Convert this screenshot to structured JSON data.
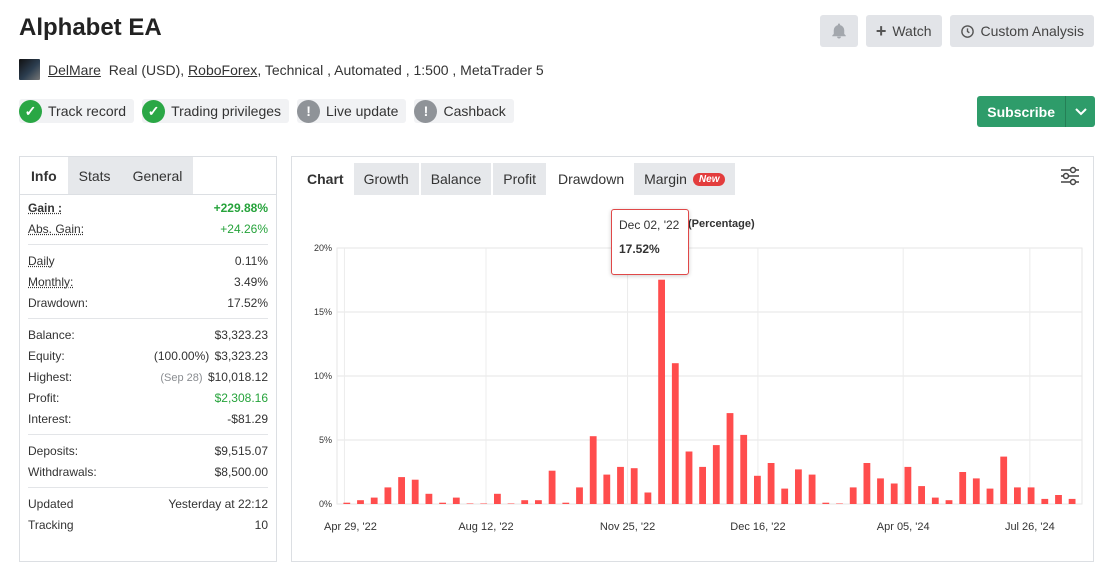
{
  "header": {
    "title": "Alphabet EA",
    "watch_label": "Watch",
    "custom_label": "Custom Analysis",
    "user": "DelMare",
    "account_type": "Real (USD),",
    "broker": "RoboForex",
    "details": ", Technical , Automated , 1:500 , MetaTrader 5"
  },
  "badges": [
    {
      "label": "Track record",
      "status": "ok"
    },
    {
      "label": "Trading privileges",
      "status": "ok"
    },
    {
      "label": "Live update",
      "status": "warn"
    },
    {
      "label": "Cashback",
      "status": "warn"
    }
  ],
  "subscribe_label": "Subscribe",
  "left_tabs": [
    "Info",
    "Stats",
    "General"
  ],
  "stats": {
    "gain_label": "Gain :",
    "gain": "+229.88%",
    "abs_gain_label": "Abs. Gain:",
    "abs_gain": "+24.26%",
    "daily_label": "Daily",
    "daily": "0.11%",
    "monthly_label": "Monthly:",
    "monthly": "3.49%",
    "drawdown_label": "Drawdown:",
    "drawdown": "17.52%",
    "balance_label": "Balance:",
    "balance": "$3,323.23",
    "equity_label": "Equity:",
    "equity_pct": "(100.00%)",
    "equity": "$3,323.23",
    "highest_label": "Highest:",
    "highest_date": "(Sep 28)",
    "highest": "$10,018.12",
    "profit_label": "Profit:",
    "profit": "$2,308.16",
    "interest_label": "Interest:",
    "interest": "-$81.29",
    "deposits_label": "Deposits:",
    "deposits": "$9,515.07",
    "withdrawals_label": "Withdrawals:",
    "withdrawals": "$8,500.00",
    "updated_label": "Updated",
    "updated": "Yesterday at 22:12",
    "tracking_label": "Tracking",
    "tracking": "10"
  },
  "chart_tabs": [
    {
      "label": "Chart",
      "style": "bold"
    },
    {
      "label": "Growth",
      "style": "gray"
    },
    {
      "label": "Balance",
      "style": "gray"
    },
    {
      "label": "Profit",
      "style": "gray"
    },
    {
      "label": "Drawdown",
      "style": "active"
    },
    {
      "label": "Margin",
      "style": "gray",
      "tag": "New"
    }
  ],
  "tooltip": {
    "date": "Dec 02, '22",
    "value": "17.52%"
  },
  "chart_data": {
    "type": "bar",
    "title": "(Percentage)",
    "color": "#ff4d4d",
    "ylim": [
      0,
      20
    ],
    "yticks": [
      "0%",
      "5%",
      "10%",
      "15%",
      "20%"
    ],
    "xticks": [
      "Apr 29, '22",
      "Aug 12, '22",
      "Nov 25, '22",
      "Dec 16, '22",
      "Apr 05, '24",
      "Jul 26, '24"
    ],
    "values": [
      0.1,
      0.3,
      0.5,
      1.3,
      2.1,
      1.9,
      0.8,
      0.1,
      0.5,
      0.0,
      0.0,
      0.8,
      0.0,
      0.3,
      0.3,
      2.6,
      0.1,
      1.3,
      5.3,
      2.3,
      2.9,
      2.8,
      0.9,
      17.52,
      11.0,
      4.1,
      2.9,
      4.6,
      7.1,
      5.4,
      2.2,
      3.2,
      1.2,
      2.7,
      2.3,
      0.1,
      0.0,
      1.3,
      3.2,
      2.0,
      1.6,
      2.9,
      1.4,
      0.5,
      0.3,
      2.5,
      2.0,
      1.2,
      3.7,
      1.3,
      1.3,
      0.4,
      0.7,
      0.4
    ]
  }
}
